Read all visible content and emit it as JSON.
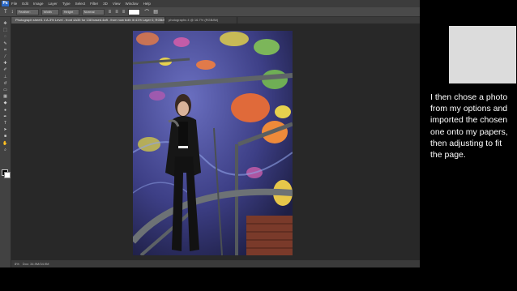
{
  "menubar": {
    "logo": "Ps",
    "items": [
      "File",
      "Edit",
      "Image",
      "Layer",
      "Type",
      "Select",
      "Filter",
      "3D",
      "View",
      "Window",
      "Help"
    ]
  },
  "options_bar": {
    "feather": "Feather:",
    "width_value": "Width",
    "height_value": "Height",
    "style_value": "Normal"
  },
  "document_tabs": [
    {
      "label": "Photograph sheet1 4 A-3% Level - front 4A35 for 138 based.4aft - from now both lit 41% Layer 0, RGB/8) *"
    },
    {
      "label": "photographs 4 @ 16.7% (RGB/8#)"
    }
  ],
  "status_bar": {
    "zoom": "8%",
    "doc_info": "Doc: 34.9M/34.9M"
  },
  "caption": {
    "text": "I then chose a photo from my options and imported the chosen one onto my papers, then adjusting to fit the page."
  },
  "colors": {
    "ps_background": "#535353",
    "canvas": "#282828",
    "slide_bg": "#000000",
    "thumb": "#dcdcdc",
    "caption": "#ffffff"
  },
  "tools": [
    "move-icon",
    "marquee-icon",
    "lasso-icon",
    "quick-select-icon",
    "crop-icon",
    "eyedropper-icon",
    "healing-icon",
    "brush-icon",
    "clone-stamp-icon",
    "history-brush-icon",
    "eraser-icon",
    "gradient-icon",
    "blur-icon",
    "dodge-icon",
    "pen-icon",
    "type-icon",
    "path-select-icon",
    "shape-icon",
    "hand-icon",
    "zoom-icon"
  ]
}
